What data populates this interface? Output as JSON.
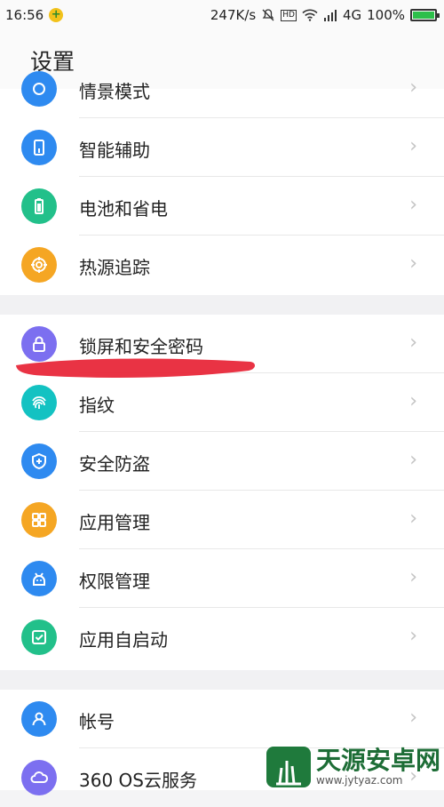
{
  "status_bar": {
    "time": "16:56",
    "speed": "247K/s",
    "network": "4G",
    "battery": "100%",
    "battery_level": 1.0
  },
  "header": {
    "title": "设置"
  },
  "items": [
    {
      "label": "情景模式",
      "icon": "mode-icon",
      "color": "#2e8af0"
    },
    {
      "label": "智能辅助",
      "icon": "smart-assist-icon",
      "color": "#2e8af0"
    },
    {
      "label": "电池和省电",
      "icon": "battery-icon",
      "color": "#22c08a"
    },
    {
      "label": "热源追踪",
      "icon": "heat-target-icon",
      "color": "#f5a623"
    },
    {
      "label": "锁屏和安全密码",
      "icon": "lock-icon",
      "color": "#7c6ff0"
    },
    {
      "label": "指纹",
      "icon": "fingerprint-icon",
      "color": "#13c2c2"
    },
    {
      "label": "安全防盗",
      "icon": "shield-icon",
      "color": "#2e8af0"
    },
    {
      "label": "应用管理",
      "icon": "apps-icon",
      "color": "#f5a623"
    },
    {
      "label": "权限管理",
      "icon": "permission-icon",
      "color": "#2e8af0"
    },
    {
      "label": "应用自启动",
      "icon": "autostart-icon",
      "color": "#22c08a"
    },
    {
      "label": "帐号",
      "icon": "account-icon",
      "color": "#2e8af0"
    },
    {
      "label": "360 OS云服务",
      "icon": "cloud-icon",
      "color": "#7c6ff0"
    }
  ],
  "watermark": {
    "name": "天源安卓网",
    "url": "www.jytyaz.com"
  }
}
